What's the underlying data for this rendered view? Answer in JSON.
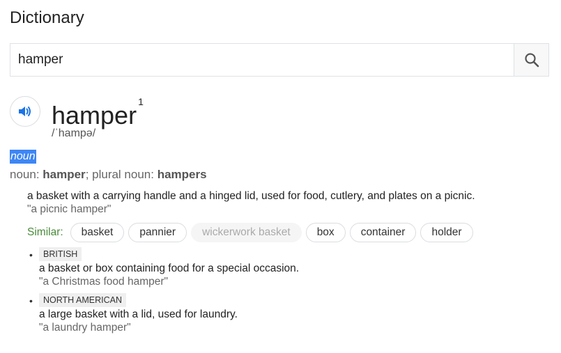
{
  "title": "Dictionary",
  "search": {
    "value": "hamper"
  },
  "entry": {
    "word": "hamper",
    "homograph": "1",
    "phonetic": "/ˈhampə/",
    "pos": "noun",
    "forms_prefix": "noun: ",
    "forms_word": "hamper",
    "forms_mid": "; plural noun: ",
    "forms_plural": "hampers",
    "definition": "a basket with a carrying handle and a hinged lid, used for food, cutlery, and plates on a picnic.",
    "example": "\"a picnic hamper\"",
    "similar_label": "Similar:",
    "similar": [
      "basket",
      "pannier",
      "wickerwork basket",
      "box",
      "container",
      "holder"
    ],
    "subsenses": [
      {
        "tag": "BRITISH",
        "definition": "a basket or box containing food for a special occasion.",
        "example": "\"a Christmas food hamper\""
      },
      {
        "tag": "NORTH AMERICAN",
        "definition": "a large basket with a lid, used for laundry.",
        "example": "\"a laundry hamper\""
      }
    ]
  }
}
